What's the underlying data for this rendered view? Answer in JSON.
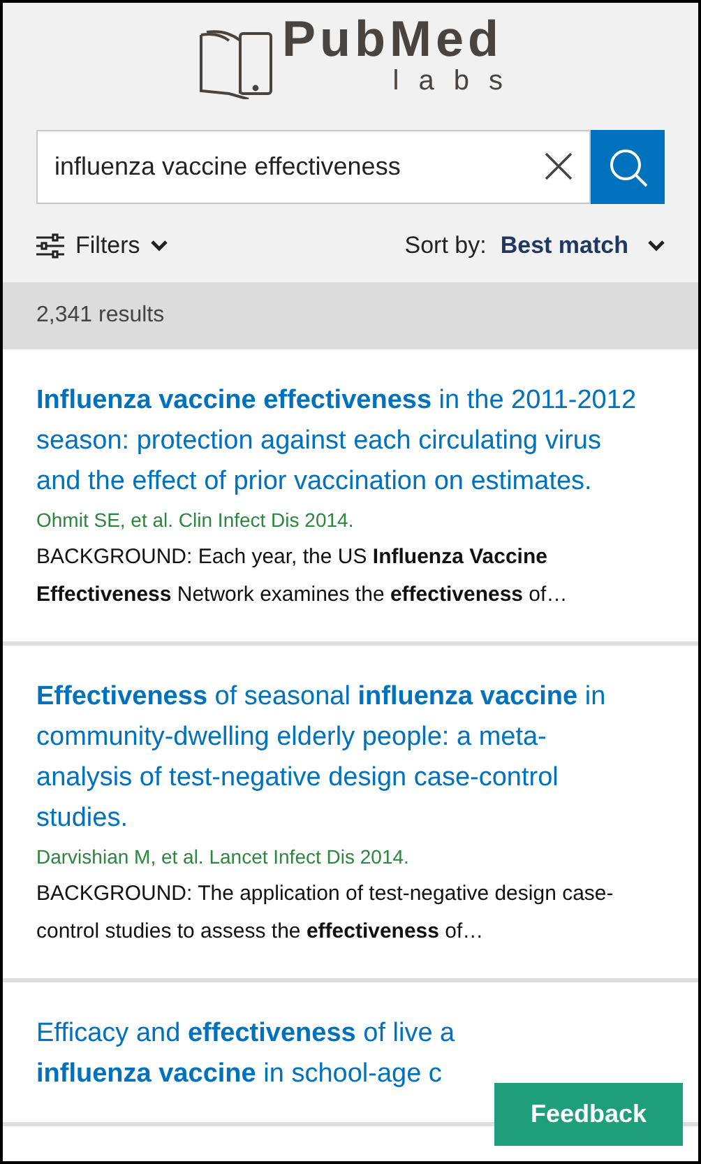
{
  "logo": {
    "name": "PubMed",
    "sub": "labs"
  },
  "search": {
    "value": "influenza vaccine effectiveness"
  },
  "filters": {
    "label": "Filters"
  },
  "sort": {
    "label": "Sort by:",
    "value": "Best match"
  },
  "results_count": "2,341 results",
  "results": [
    {
      "title_lines": [
        "**Influenza vaccine effectiveness** in the 2011-2012 season: protection against each circulating virus and the effect of prior vaccination on estimates."
      ],
      "citation": "Ohmit SE, et al. Clin Infect Dis 2014.",
      "snippet": "BACKGROUND: Each year, the US **Influenza Vaccine Effectiveness** Network examines the **effectiveness** of…"
    },
    {
      "title_lines": [
        "**Effectiveness** of seasonal **influenza vaccine** in community-dwelling elderly people: a meta-analysis of test-negative design case-control studies."
      ],
      "citation": "Darvishian M, et al. Lancet Infect Dis 2014.",
      "snippet": "BACKGROUND: The application of test-negative design case-control studies to assess the **effectiveness** of…"
    },
    {
      "title_lines": [
        "Efficacy and **effectiveness** of live a",
        "**influenza vaccine** in school-age c"
      ]
    }
  ],
  "feedback": {
    "label": "Feedback"
  }
}
